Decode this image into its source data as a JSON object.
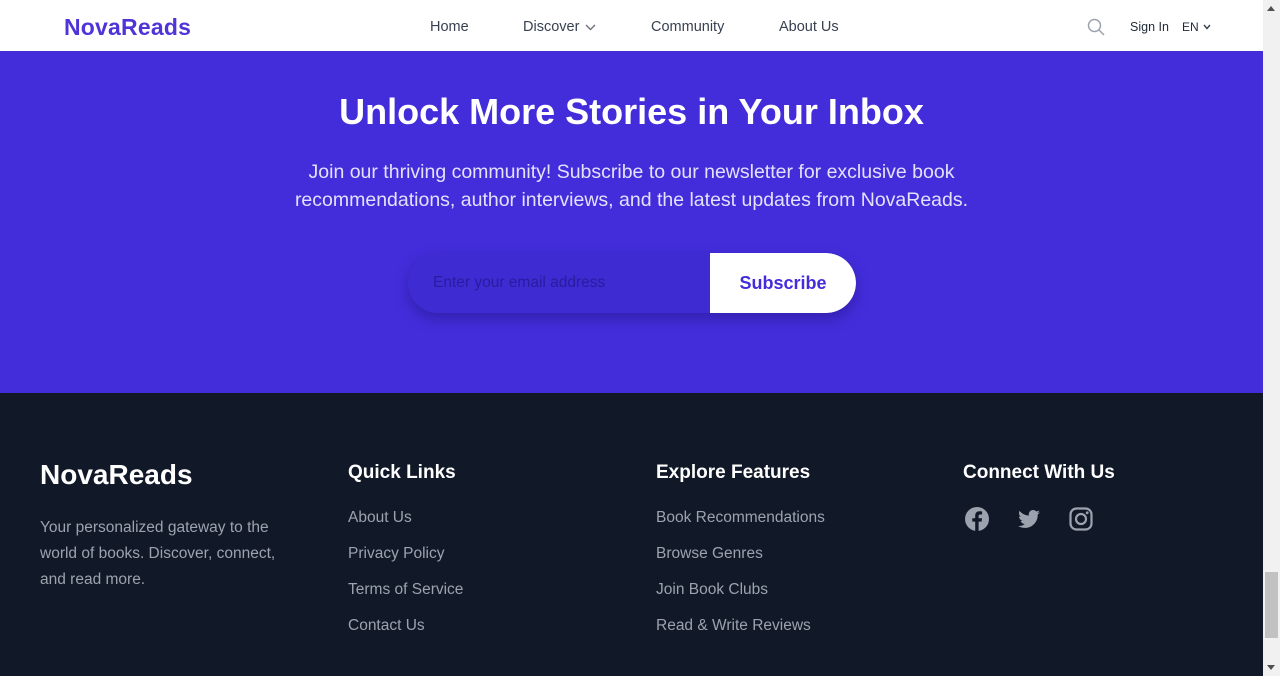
{
  "header": {
    "logo": "NovaReads",
    "nav": {
      "home": "Home",
      "discover": "Discover",
      "community": "Community",
      "about": "About Us"
    },
    "sign_in": "Sign In",
    "language": "EN"
  },
  "hero": {
    "title": "Unlock More Stories in Your Inbox",
    "description": "Join our thriving community! Subscribe to our newsletter for exclusive book recommendations, author interviews, and the latest updates from NovaReads.",
    "email_placeholder": "Enter your email address",
    "subscribe_label": "Subscribe"
  },
  "footer": {
    "brand": "NovaReads",
    "tagline": "Your personalized gateway to the world of books. Discover, connect, and read more.",
    "quick_links": {
      "heading": "Quick Links",
      "items": [
        "About Us",
        "Privacy Policy",
        "Terms of Service",
        "Contact Us"
      ]
    },
    "features": {
      "heading": "Explore Features",
      "items": [
        "Book Recommendations",
        "Browse Genres",
        "Join Book Clubs",
        "Read & Write Reviews"
      ]
    },
    "connect": {
      "heading": "Connect With Us",
      "icons": [
        "facebook-icon",
        "twitter-icon",
        "instagram-icon"
      ]
    }
  },
  "colors": {
    "brand": "#4f35d8",
    "hero_bg": "#432ddb",
    "footer_bg": "#111827",
    "muted_text": "#9ca3af"
  }
}
